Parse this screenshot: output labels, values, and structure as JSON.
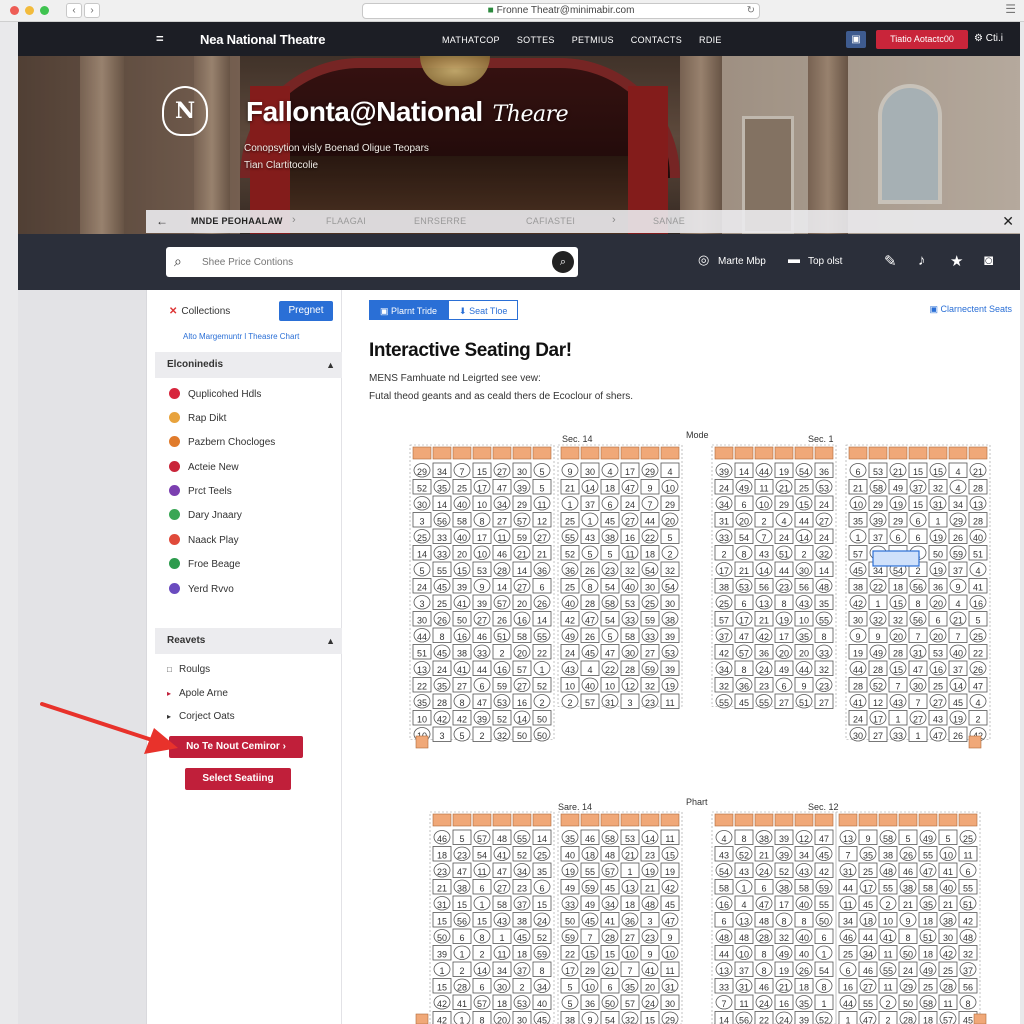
{
  "browser": {
    "url": "Fronne Theatr@minimabir.com"
  },
  "nav": {
    "menu_glyph": "=",
    "brand_short": "☰",
    "brand": "Nea National Theatre",
    "links": [
      "MATHATCOP",
      "SOTTES",
      "PETMIUS",
      "CONTACTS",
      "RDIE"
    ],
    "cta_label": "Tiatio Aotactc00",
    "settings_label": "⚙ Cti.i"
  },
  "hero": {
    "logo_text": "N",
    "title_main": "Fallonta@National",
    "title_serif": "Theare",
    "subtitle_line1": "Conopsytion visly Boenad Oligue Teopars",
    "subtitle_line2": "Tian Clartitocolie"
  },
  "breadcrumb": {
    "items": [
      "MNDE PEOHAALAW",
      "FLAAGAI",
      "ENRSERRE",
      "CAFIASTEI",
      "SANAE"
    ]
  },
  "toolbar": {
    "search_placeholder": "Shee Price Contions",
    "mark_map_label": "Marte Mbp",
    "top_dist_label": "Top olst"
  },
  "sidebar": {
    "collections_label": "Collections",
    "pregnet_label": "Pregnet",
    "link_text": "Alto Margemuntr l Theasre Chart",
    "section1_title": "Elconinedis",
    "section1_items": [
      {
        "label": "Quplicohed Hdls",
        "color": "#d7263d"
      },
      {
        "label": "Rap Dikt",
        "color": "#e8a33d"
      },
      {
        "label": "Pazbern Chocloges",
        "color": "#e07b2c"
      },
      {
        "label": "Acteie New",
        "color": "#c9253a"
      },
      {
        "label": "Prct Teels",
        "color": "#7b3fb0"
      },
      {
        "label": "Dary Jnaary",
        "color": "#3aa655"
      },
      {
        "label": "Naack Play",
        "color": "#e04a3a"
      },
      {
        "label": "Froe Beage",
        "color": "#2d9b4d"
      },
      {
        "label": "Yerd Rvvo",
        "color": "#6a4bbf"
      }
    ],
    "section2_title": "Reavets",
    "section2_items": [
      {
        "label": "Roulgs",
        "marker": "□"
      },
      {
        "label": "Apole Arne",
        "marker": "▸"
      },
      {
        "label": "Corject Oats",
        "marker": "▸"
      }
    ],
    "btn_next": "No Te Nout Cemiror ›",
    "btn_select": "Select Seatiing"
  },
  "main": {
    "tab_active": "▣ Plarnt Tride",
    "tab_inactive": "⬇ Seat Tloe",
    "connect_label": "▣ Clarnectent Seats",
    "title": "Interactive Seating Dar!",
    "sub_line1": "MENS Famhuate nd Leigrted see vew:",
    "sub_line2": "Futal theod geants and as ceald thers de Ecoclour of shers.",
    "upper_labels": [
      "Sec. 14",
      "Mode",
      "Sec. 1"
    ],
    "lower_labels": [
      "Sare. 14",
      "Phart",
      "Sec. 12"
    ]
  },
  "seat_colors": {
    "header_fill": "#f0a878",
    "header_stroke": "#b06a3a",
    "seat_stroke": "#555555",
    "highlight": "#2a6fd6"
  }
}
